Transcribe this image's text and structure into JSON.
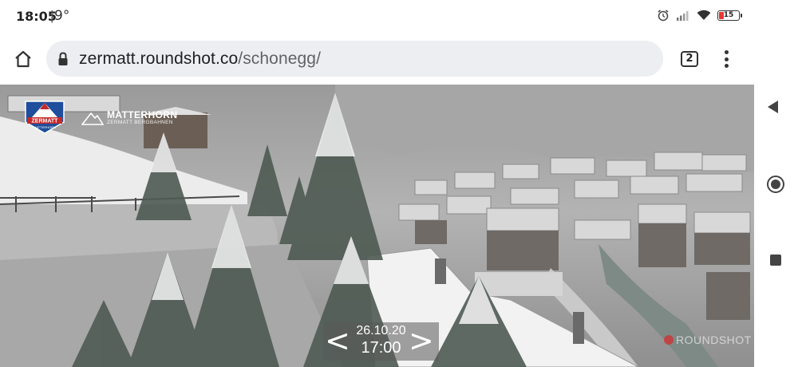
{
  "status_bar": {
    "time": "18:05",
    "temperature": "9°",
    "battery_level": "15",
    "icons": [
      "alarm-icon",
      "signal-icon",
      "wifi-icon",
      "battery-icon"
    ]
  },
  "browser": {
    "url_domain": "zermatt.roundshot.co",
    "url_path": "/schonegg/",
    "tab_count": "2",
    "icons": [
      "home-icon",
      "lock-icon",
      "tab-switcher-icon",
      "overflow-menu-icon"
    ]
  },
  "webcam": {
    "logo_zermatt_title": "ZERMATT",
    "logo_zermatt_sub": "MATTERHORN",
    "logo_matterhorn_title": "MATTERHORN",
    "logo_matterhorn_sub": "ZERMATT BERGBAHNEN",
    "date": "26.10.20",
    "time": "17:00",
    "prev_label": "<",
    "next_label": ">",
    "watermark": "ROUNDSHOT"
  },
  "android_nav": {
    "icons": [
      "back-icon",
      "home-circle-icon",
      "recents-icon"
    ]
  },
  "colors": {
    "accent_battery": "#e53935",
    "url_bar_bg": "#eceef1",
    "zermatt_logo_red": "#c62828",
    "zermatt_logo_blue": "#1e4e9c"
  }
}
